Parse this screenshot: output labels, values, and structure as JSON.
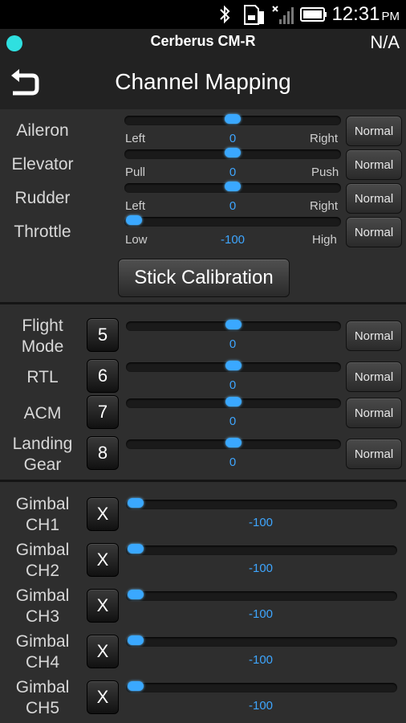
{
  "status_bar": {
    "time": "12:31",
    "ampm": "PM"
  },
  "header": {
    "device_name": "Cerberus CM-R",
    "connection_status": "N/A",
    "title": "Channel Mapping"
  },
  "sticks": [
    {
      "label": "Aileron",
      "min_label": "Left",
      "max_label": "Right",
      "value": "0",
      "mode": "Normal",
      "level": 0.5
    },
    {
      "label": "Elevator",
      "min_label": "Pull",
      "max_label": "Push",
      "value": "0",
      "mode": "Normal",
      "level": 0.5
    },
    {
      "label": "Rudder",
      "min_label": "Left",
      "max_label": "Right",
      "value": "0",
      "mode": "Normal",
      "level": 0.5
    },
    {
      "label": "Throttle",
      "min_label": "Low",
      "max_label": "High",
      "value": "-100",
      "mode": "Normal",
      "level": 0.0
    }
  ],
  "stick_calibration_label": "Stick Calibration",
  "aux_channels": [
    {
      "line1": "Flight",
      "line2": "Mode",
      "channel": "5",
      "value": "0",
      "mode": "Normal",
      "level": 0.5
    },
    {
      "line1": "RTL",
      "line2": "",
      "channel": "6",
      "value": "0",
      "mode": "Normal",
      "level": 0.5
    },
    {
      "line1": "ACM",
      "line2": "",
      "channel": "7",
      "value": "0",
      "mode": "Normal",
      "level": 0.5
    },
    {
      "line1": "Landing",
      "line2": "Gear",
      "channel": "8",
      "value": "0",
      "mode": "Normal",
      "level": 0.5
    }
  ],
  "gimbal_channels": [
    {
      "line1": "Gimbal",
      "line2": "CH1",
      "channel": "X",
      "value": "-100",
      "level": 0.0
    },
    {
      "line1": "Gimbal",
      "line2": "CH2",
      "channel": "X",
      "value": "-100",
      "level": 0.0
    },
    {
      "line1": "Gimbal",
      "line2": "CH3",
      "channel": "X",
      "value": "-100",
      "level": 0.0
    },
    {
      "line1": "Gimbal",
      "line2": "CH4",
      "channel": "X",
      "value": "-100",
      "level": 0.0
    },
    {
      "line1": "Gimbal",
      "line2": "CH5",
      "channel": "X",
      "value": "-100",
      "level": 0.0
    }
  ],
  "icons": [
    "bluetooth-icon",
    "sd-card-icon",
    "signal-icon",
    "battery-icon",
    "back-icon"
  ],
  "colors": {
    "accent": "#3aa8ff",
    "connection": "#2fe0e0",
    "background": "#2e2e2e"
  }
}
